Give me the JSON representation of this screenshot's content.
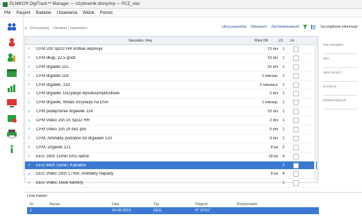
{
  "window": {
    "title": "ELMIKO® DigiTrack™ Manager — Użytkownik domyślny — PCZ_stac"
  },
  "menu": [
    "Plik",
    "Pacjent",
    "Badanie",
    "Ustawienia",
    "Widok",
    "Pomoc"
  ],
  "search": {
    "placeholder": "Przeszukuj... <Imiona / nazwisko>"
  },
  "filters": [
    "Ukryj pacjentów",
    "Opisanych",
    "Zarchiwizowanych"
  ],
  "right_panel": {
    "header": "Szczegółowe informacje",
    "labels": [
      "Imię Nazwisko",
      "Płeć",
      "Wiek (Urodz.)",
      "Urodzony",
      "Zeskanowany BI"
    ]
  },
  "table": {
    "headers": [
      "Nazwisko, Imię",
      "Wiek OR",
      "LO",
      "LA"
    ],
    "rows": [
      {
        "sex": "f",
        "name": "CFM 2ch SpO2 HR krótkie depresje",
        "dur": "13 dni",
        "lo": "1"
      },
      {
        "sex": "f",
        "name": "CFM długi, 22,5 godz",
        "dur": "10 dni",
        "lo": "1"
      },
      {
        "sex": "m",
        "name": "CFM drgawki 115",
        "dur": "10 dni",
        "lo": "1"
      },
      {
        "sex": "f",
        "name": "CFM drgawki 118",
        "dur": "1 miesiąc",
        "lo": "1"
      },
      {
        "sex": "f",
        "name": "CFM drgawki, 119",
        "dur": "2 miesiące",
        "lo": "1"
      },
      {
        "sex": "f",
        "name": "CFM drgawki, Oscylacje wysokoamplifudowe",
        "dur": "2 dni",
        "lo": "1"
      },
      {
        "sex": "f",
        "name": "CFM drgawki, Widać oscylacje na DSA",
        "dur": "1 miesiąc",
        "lo": "1"
      },
      {
        "sex": "f",
        "name": "CFM podejrzenie drgawek 114",
        "dur": "10 dni",
        "lo": "1"
      },
      {
        "sex": "f",
        "name": "CFM Video 2ch 1h SpO2 HR",
        "dur": "2 dni",
        "lo": "1"
      },
      {
        "sex": "m",
        "name": "CFM Video 2ch 2h bez pox",
        "dur": "5 dni",
        "lo": "1"
      },
      {
        "sex": "f",
        "name": "CFM, Artefakty podobne do drgawek 120",
        "dur": "9 dni",
        "lo": "1"
      },
      {
        "sex": "f",
        "name": "CFM, Drgawki 121",
        "dur": "8 lat",
        "lo": "2"
      },
      {
        "sex": "f",
        "name": "EEG 19ch 15min EKG ładne",
        "dur": "18 lat",
        "lo": "4"
      },
      {
        "sex": "m",
        "name": "EEG 64ch 15min, Kanałów",
        "dur": "",
        "lo": "2",
        "selected": true
      },
      {
        "sex": "m",
        "name": "EEG Video 19ch 17min, Artefakty Napady",
        "dur": "8 lat",
        "lo": "4"
      },
      {
        "sex": "f",
        "name": "EEG Video, Dwie kamery",
        "dur": "",
        "lo": "1"
      }
    ]
  },
  "bottom": {
    "title": "Lista badań:",
    "headers": [
      "Nr",
      "Nazwa",
      "Data",
      "Typ",
      "Długość",
      "Rozpoznanie"
    ],
    "row": [
      "1",
      "",
      "04.09.2012",
      "EEG",
      "0° 16'51\"",
      ""
    ]
  },
  "colors": {
    "accent": "#3b78d2",
    "female": "#2a9d3a",
    "male": "#1f5fbf"
  }
}
